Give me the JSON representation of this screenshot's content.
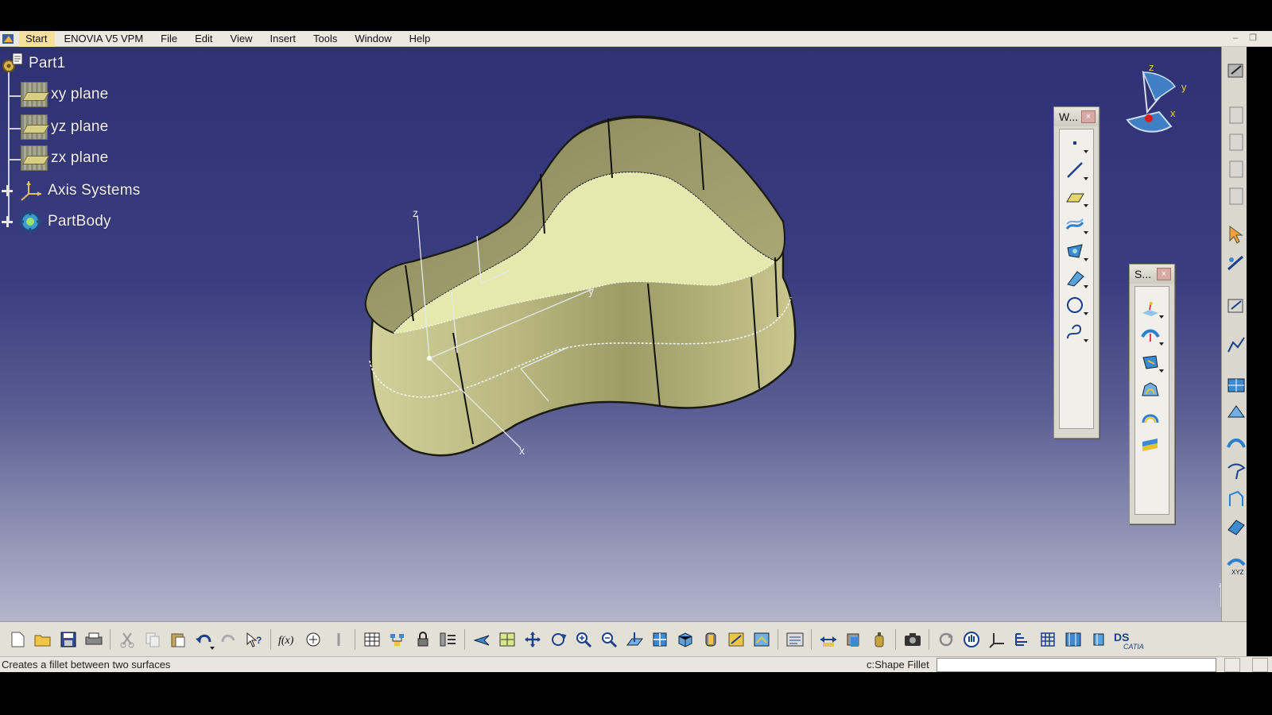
{
  "menubar": {
    "items": [
      "Start",
      "ENOVIA V5 VPM",
      "File",
      "Edit",
      "View",
      "Insert",
      "Tools",
      "Window",
      "Help"
    ]
  },
  "tree": {
    "root": "Part1",
    "nodes": [
      {
        "label": "xy plane",
        "icon": "plane-icon"
      },
      {
        "label": "yz plane",
        "icon": "plane-icon"
      },
      {
        "label": "zx plane",
        "icon": "plane-icon"
      },
      {
        "label": "Axis Systems",
        "icon": "axis-systems-icon"
      },
      {
        "label": "PartBody",
        "icon": "partbody-icon"
      }
    ]
  },
  "floating_toolbars": {
    "wireframe": {
      "title": "W..."
    },
    "surfaces": {
      "title": "S..."
    }
  },
  "compass": {
    "x": "x",
    "y": "y",
    "z": "z"
  },
  "model_axes": {
    "x": "x",
    "y": "y",
    "z": "z"
  },
  "statusbar": {
    "message": "Creates a fillet between two surfaces",
    "command": "c:Shape Fillet",
    "input_value": ""
  },
  "brand": "CATIA",
  "colors": {
    "viewport_top": "#2f3175",
    "viewport_bottom": "#b9bbd0",
    "part_surface": "#c9c78e",
    "part_top_face": "#e6e8ae",
    "start_highlight": "#f7dfa1"
  }
}
